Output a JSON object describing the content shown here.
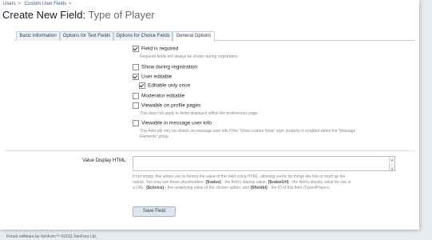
{
  "breadcrumb": [
    "Users",
    "Custom User Fields"
  ],
  "breadcrumb_separator": ">",
  "page": {
    "title": "Create New Field:",
    "subtitle": "Type of Player"
  },
  "tabs": [
    {
      "label": "Basic Information",
      "active": false
    },
    {
      "label": "Options for Text Fields",
      "active": false
    },
    {
      "label": "Options for Choice Fields",
      "active": false
    },
    {
      "label": "General Options",
      "active": true
    }
  ],
  "options": [
    {
      "label": "Field is required",
      "checked": true,
      "hint": "Required fields will always be shown during registration."
    },
    {
      "label": "Show during registration",
      "checked": false
    },
    {
      "label": "User editable",
      "checked": true
    },
    {
      "label": "Editable only once",
      "checked": true
    },
    {
      "label": "Moderator editable",
      "checked": false
    },
    {
      "label": "Viewable on profile pages",
      "checked": false,
      "hint": "This does not apply to fields displayed within the preferences page."
    },
    {
      "label": "Viewable in message user info",
      "checked": false,
      "hint_lines": [
        "This field will only be shown on message user info if the 'Show custom fields' style property is enabled within the 'Message",
        "Elements' group."
      ]
    }
  ],
  "value_display": {
    "label": "Value Display HTML:",
    "value": "",
    "scroll_up": "▲",
    "scroll_down": "▼",
    "help": {
      "line1": "If not empty, this allows you to format the value of this field using HTML, allowing you to do things like link or mark up the",
      "line2_a": "output. You may use these placeholders:",
      "token_value": "{$value}",
      "line2_b": "- the field's display value;",
      "token_valueUrl": "{$valueUrl}",
      "line2_c": "- the field's display value for use in",
      "line3_a": "a URL;",
      "token_choice": "{$choice}",
      "line3_b": "- the underlying value of the chosen option; and",
      "token_fieldId": "{$fieldId}",
      "line3_c": "- the ID of this field (TypeofPlayer)."
    }
  },
  "save_button": "Save Field",
  "footer": "Forum software by XenForo™ ©2011 XenForo Ltd."
}
